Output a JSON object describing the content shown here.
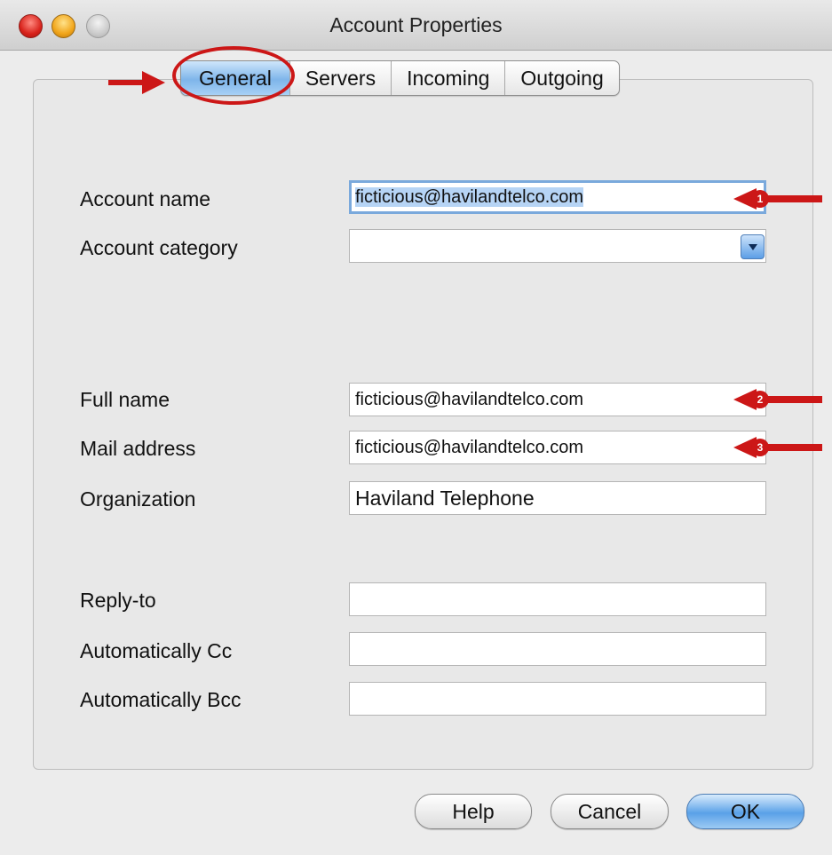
{
  "window": {
    "title": "Account Properties"
  },
  "tabs": [
    {
      "label": "General",
      "active": true
    },
    {
      "label": "Servers",
      "active": false
    },
    {
      "label": "Incoming",
      "active": false
    },
    {
      "label": "Outgoing",
      "active": false
    }
  ],
  "form": {
    "account_name": {
      "label": "Account name",
      "value": "ficticious@havilandtelco.com"
    },
    "account_category": {
      "label": "Account category",
      "value": ""
    },
    "full_name": {
      "label": "Full name",
      "value": "ficticious@havilandtelco.com"
    },
    "mail_address": {
      "label": "Mail address",
      "value": "ficticious@havilandtelco.com"
    },
    "organization": {
      "label": "Organization",
      "value": "Haviland Telephone"
    },
    "reply_to": {
      "label": "Reply-to",
      "value": ""
    },
    "auto_cc": {
      "label": "Automatically Cc",
      "value": ""
    },
    "auto_bcc": {
      "label": "Automatically Bcc",
      "value": ""
    }
  },
  "buttons": {
    "help": "Help",
    "cancel": "Cancel",
    "ok": "OK"
  },
  "annotations": {
    "badge1": "1",
    "badge2": "2",
    "badge3": "3"
  },
  "colors": {
    "annotation_red": "#cc1717",
    "selection_blue": "#b6d4f5",
    "accent_blue": "#5aa1e8"
  }
}
